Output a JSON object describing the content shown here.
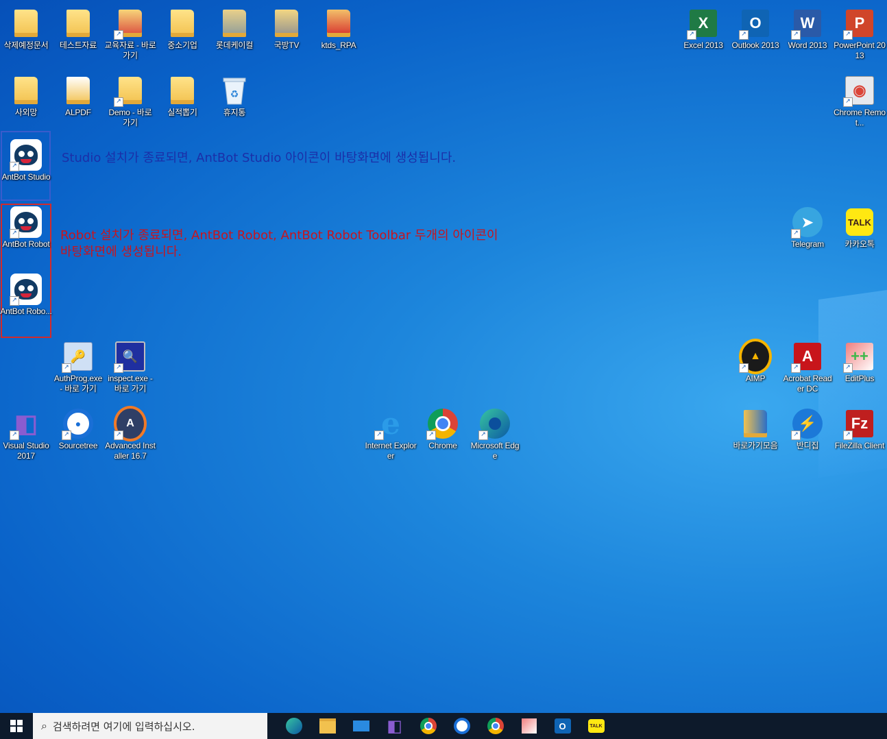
{
  "desktop": {
    "icons_top_left": [
      {
        "id": "del-docs",
        "label": "삭제예정문서"
      },
      {
        "id": "test-data",
        "label": "테스트자료"
      },
      {
        "id": "edu-data",
        "label": "교육자료 - 바로 가기"
      },
      {
        "id": "sme",
        "label": "중소기업"
      },
      {
        "id": "lotte",
        "label": "롯데케이컬"
      },
      {
        "id": "ktv",
        "label": "국방TV"
      },
      {
        "id": "ktds",
        "label": "ktds_RPA"
      }
    ],
    "icons_row2": [
      {
        "id": "intranet",
        "label": "사외망"
      },
      {
        "id": "alpdf",
        "label": "ALPDF"
      },
      {
        "id": "demo",
        "label": "Demo - 바로 가기"
      },
      {
        "id": "perf",
        "label": "실적뽑기"
      },
      {
        "id": "recycle",
        "label": "휴지통"
      }
    ],
    "antbot_studio": "AntBot Studio",
    "antbot_robot": "AntBot Robot",
    "antbot_toolbar": "AntBot Robo...",
    "note_studio": "Studio 설치가 종료되면, AntBot Studio 아이콘이 바탕화면에 생성됩니다.",
    "note_robot": "Robot 설치가 종료되면, AntBot Robot, AntBot Robot Toolbar 두개의 아이콘이 바탕화면에 생성됩니다.",
    "authprog": "AuthProg.exe - 바로 가기",
    "inspect": "inspect.exe - 바로 가기",
    "vs2017": "Visual Studio 2017",
    "sourcetree": "Sourcetree",
    "advinst": "Advanced Installer 16.7",
    "ie": "Internet Explorer",
    "chrome": "Chrome",
    "edge": "Microsoft Edge",
    "excel": "Excel 2013",
    "outlook": "Outlook 2013",
    "word": "Word 2013",
    "ppt": "PowerPoint 2013",
    "chrome_remote": "Chrome Remot...",
    "telegram": "Telegram",
    "kakao": "카카오톡",
    "aimp": "AIMP",
    "acrobat": "Acrobat Reader DC",
    "editplus": "EditPlus",
    "shortcuts": "바로가기모음",
    "bandizip": "반디집",
    "filezilla": "FileZilla Client"
  },
  "taskbar": {
    "search_placeholder": "검색하려면 여기에 입력하십시오.",
    "pinned": [
      "edge-icon",
      "file-explorer-icon",
      "mail-icon",
      "visual-studio-icon",
      "chrome-icon",
      "sourcetree-icon",
      "chrome-icon",
      "editplus-icon",
      "outlook-icon",
      "kakaotalk-icon"
    ]
  },
  "colors": {
    "highlight_blue": "#3a5ccc",
    "highlight_red": "#d42a2a",
    "note_blue": "#1b2fa8",
    "note_red": "#c8141e"
  }
}
